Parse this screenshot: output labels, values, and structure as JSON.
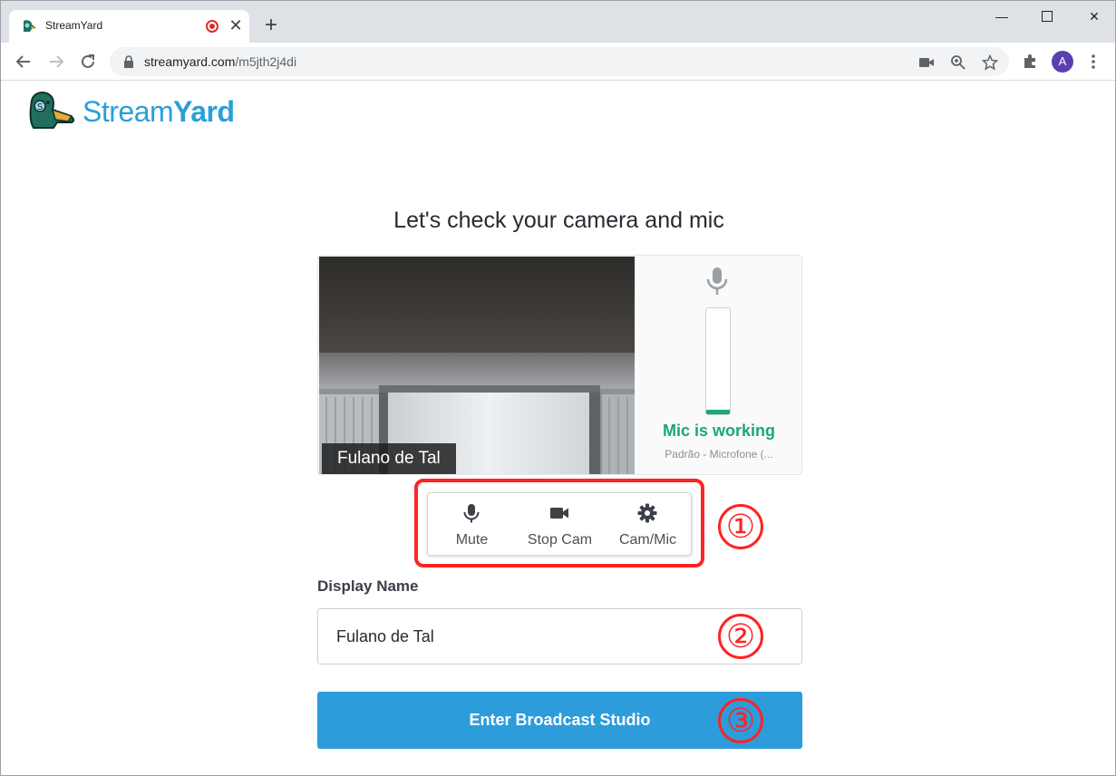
{
  "browser": {
    "tab_title": "StreamYard",
    "url_host": "streamyard.com",
    "url_path": "/m5jth2j4di",
    "avatar_letter": "A"
  },
  "page": {
    "logo_text_light": "Stream",
    "logo_text_bold": "Yard",
    "heading": "Let's check your camera and mic",
    "preview": {
      "name_tag": "Fulano de Tal",
      "mic_status": "Mic is working",
      "mic_device": "Padrão - Microfone (...",
      "mic_level": 0.04
    },
    "controls": {
      "mute_label": "Mute",
      "stopcam_label": "Stop Cam",
      "cammic_label": "Cam/Mic"
    },
    "display_name": {
      "label": "Display Name",
      "value": "Fulano de Tal"
    },
    "enter_button": "Enter Broadcast Studio",
    "annotations": [
      "①",
      "②",
      "③"
    ]
  },
  "colors": {
    "brand_blue": "#2a9fd8",
    "button_blue": "#2d9cdb",
    "mic_green": "#1aa67f",
    "highlight_red": "#ff2323"
  }
}
